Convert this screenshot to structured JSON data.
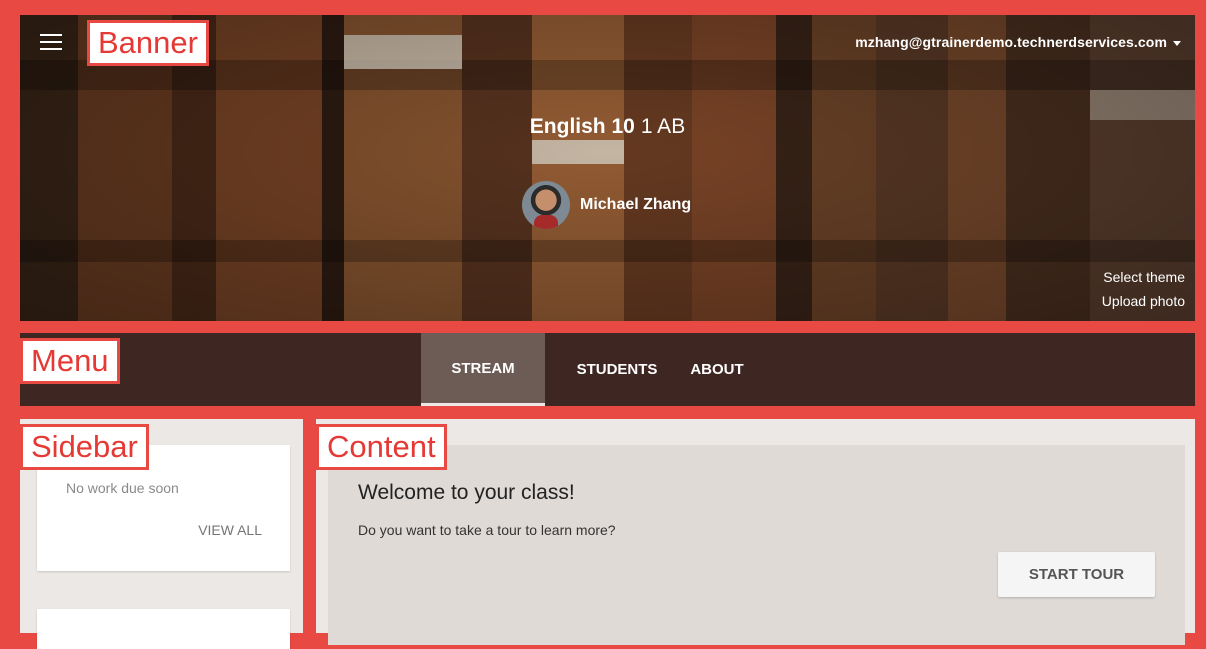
{
  "banner": {
    "label": "Banner",
    "account_email": "mzhang@gtrainerdemo.technerdservices.com",
    "class_name": "English 10",
    "class_section": "1 AB",
    "teacher_name": "Michael Zhang",
    "select_theme": "Select theme",
    "upload_photo": "Upload photo"
  },
  "menu": {
    "label": "Menu",
    "tabs": [
      {
        "label": "STREAM",
        "active": true
      },
      {
        "label": "STUDENTS",
        "active": false
      },
      {
        "label": "ABOUT",
        "active": false
      }
    ]
  },
  "sidebar": {
    "label": "Sidebar",
    "upcoming_text": "No work due soon",
    "view_all": "VIEW ALL"
  },
  "content": {
    "label": "Content",
    "welcome_title": "Welcome to your class!",
    "welcome_text": "Do you want to take a tour to learn more?",
    "start_tour": "START TOUR"
  },
  "colors": {
    "annotation_red": "#e84a43",
    "menu_bg": "#3e2723",
    "active_tab_bg": "#6d5b55",
    "page_bg": "#ece8e5"
  },
  "icons": {
    "menu": "hamburger-icon",
    "account_dropdown": "caret-down-icon"
  }
}
